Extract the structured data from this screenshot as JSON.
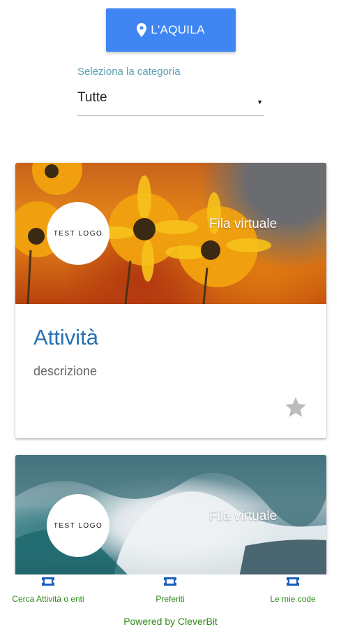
{
  "header": {
    "city_button_label": "L'AQUILA",
    "city_button_color": "#3f86f2"
  },
  "category": {
    "label": "Seleziona la categoria",
    "selected": "Tutte"
  },
  "cards": [
    {
      "logo_text": "TEST LOGO",
      "caption": "Fila virtuale",
      "title": "Attività",
      "description": "descrizione",
      "image": "flowers"
    },
    {
      "logo_text": "TEST LOGO",
      "caption": "Fila virtuale",
      "image": "waves"
    }
  ],
  "bottom_nav": {
    "items": [
      {
        "label": "Cerca Attività o enti",
        "icon": "ticket-icon"
      },
      {
        "label": "Preferiti",
        "icon": "ticket-icon"
      },
      {
        "label": "Le mie code",
        "icon": "ticket-icon"
      }
    ],
    "powered_by": "Powered by CleverBit",
    "accent_color": "#2e8a1a"
  },
  "colors": {
    "title": "#2670b2",
    "category_label": "#5b9fb0"
  }
}
